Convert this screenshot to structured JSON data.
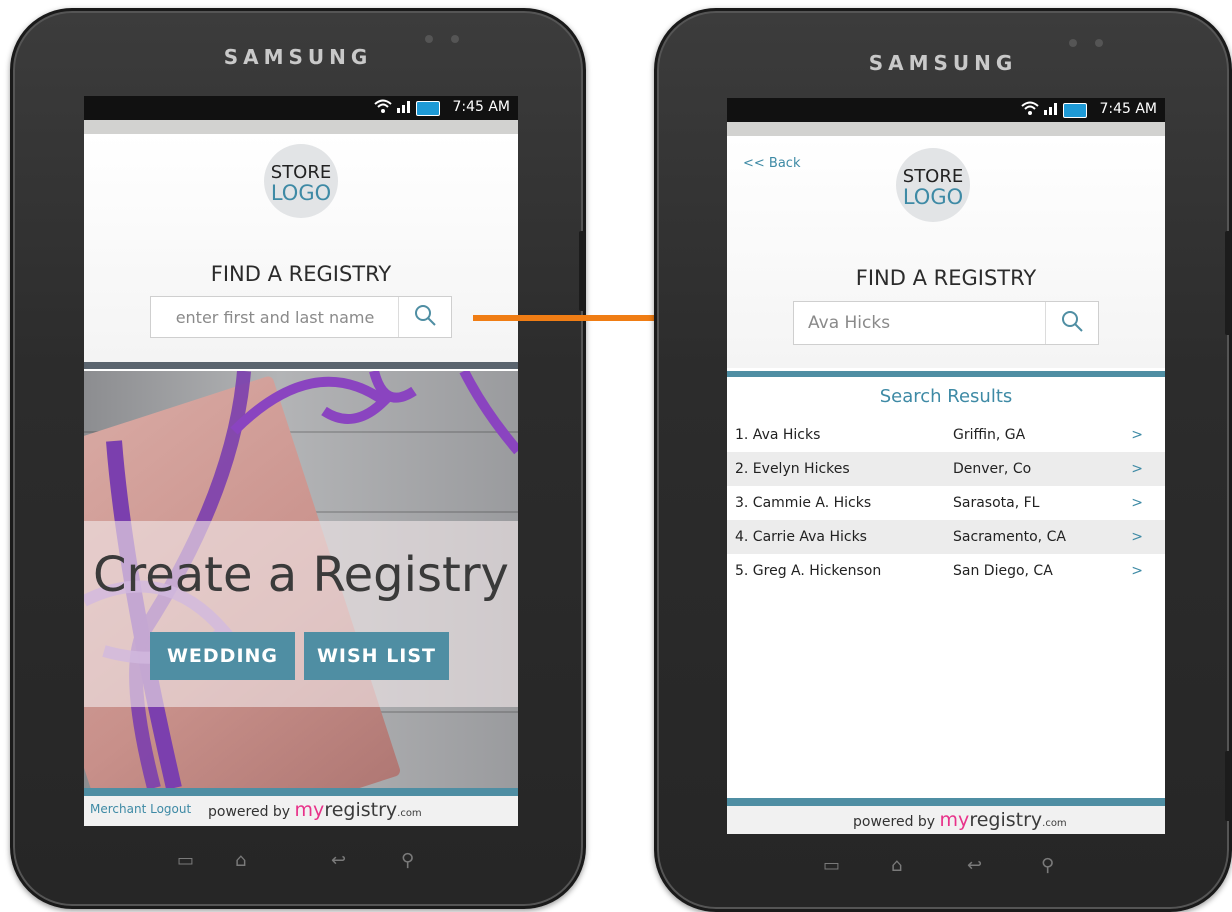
{
  "left": {
    "brand": "SAMSUNG",
    "status_time": "7:45 AM",
    "logo_line1": "STORE",
    "logo_line2": "LOGO",
    "find_title": "FIND A REGISTRY",
    "search_placeholder": "enter first and last name",
    "hero_title": "Create a Registry",
    "wedding_label": "WEDDING",
    "wishlist_label": "WISH LIST",
    "merchant_logout": "Merchant Logout",
    "powered_by": "powered by",
    "brand_my": "my",
    "brand_registry": "registry",
    "brand_com": ".com"
  },
  "right": {
    "brand": "SAMSUNG",
    "status_time": "7:45 AM",
    "back_label": "<< Back",
    "logo_line1": "STORE",
    "logo_line2": "LOGO",
    "find_title": "FIND A REGISTRY",
    "search_value": "Ava Hicks",
    "results_title": "Search Results",
    "results": [
      {
        "name": "1.  Ava Hicks",
        "city": "Griffin, GA",
        "chev": ">"
      },
      {
        "name": "2.  Evelyn Hickes",
        "city": "Denver, Co",
        "chev": ">"
      },
      {
        "name": "3.  Cammie A. Hicks",
        "city": "Sarasota, FL",
        "chev": ">"
      },
      {
        "name": "4.  Carrie Ava Hicks",
        "city": "Sacramento, CA",
        "chev": ">"
      },
      {
        "name": "5.  Greg A. Hickenson",
        "city": "San Diego, CA",
        "chev": ">"
      }
    ],
    "powered_by": "powered by",
    "brand_my": "my",
    "brand_registry": "registry",
    "brand_com": ".com"
  },
  "colors": {
    "accent": "#4f8ea3",
    "link": "#3e8aa5",
    "arrow": "#f07d14",
    "brand_pink": "#e8328a"
  }
}
